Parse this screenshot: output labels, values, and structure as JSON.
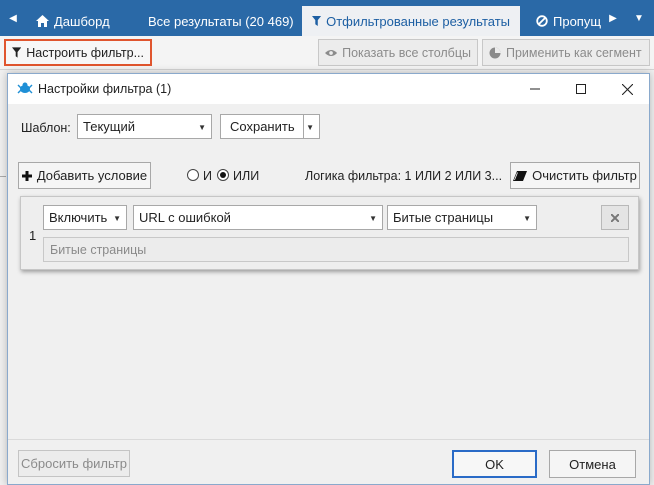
{
  "tabs": {
    "scroll_left": "◀",
    "scroll_right": "▶",
    "menu": "▼",
    "dashboard": "Дашборд",
    "all_results": "Все результаты (20 469)",
    "filtered_results": "Отфильтрованные результаты",
    "skipped": "Пропущ"
  },
  "toolbar": {
    "configure_filter": "Настроить фильтр...",
    "show_all_columns": "Показать все столбцы",
    "apply_as_segment": "Применить как сегмент"
  },
  "dialog": {
    "title": "Настройки фильтра (1)",
    "template_label": "Шаблон:",
    "template_value": "Текущий",
    "save_label": "Сохранить",
    "add_condition": "Добавить условие",
    "logic_and": "И",
    "logic_or": "ИЛИ",
    "logic_selected": "ИЛИ",
    "filter_logic": "Логика фильтра: 1 ИЛИ 2 ИЛИ 3...",
    "clear_filter": "Очистить фильтр",
    "condition": {
      "number": "1",
      "mode": "Включить",
      "field": "URL с ошибкой",
      "value": "Битые страницы",
      "summary": "Битые страницы"
    },
    "reset_filter": "Сбросить фильтр",
    "ok": "OK",
    "cancel": "Отмена"
  },
  "icons": [
    "home-icon",
    "filter-icon",
    "forbidden-icon",
    "eye-icon",
    "pie-chart-icon",
    "app-logo-icon",
    "minimize-icon",
    "maximize-icon",
    "close-icon",
    "plus-icon",
    "eraser-icon",
    "remove-icon"
  ],
  "colors": {
    "tabbar": "#2a69a7",
    "active_tab_text": "#1d5fa3",
    "highlight_border": "#e0552e",
    "primary_border": "#2a6bc7"
  }
}
